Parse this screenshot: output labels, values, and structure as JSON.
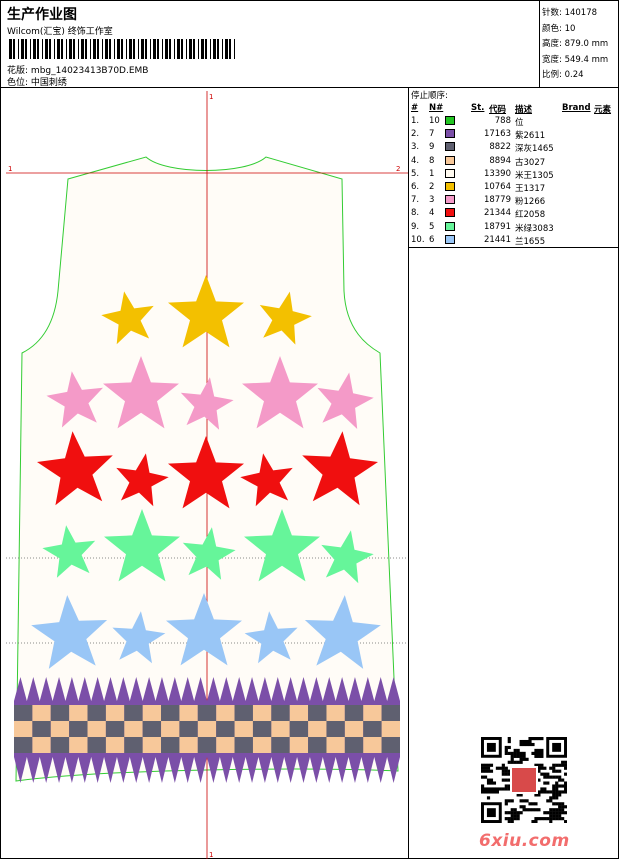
{
  "header": {
    "title": "生产作业图",
    "company": "Wilcom(汇宝) 终饰工作室",
    "design_label": "花版:",
    "design_value": "mbg_14023413B70D.EMB",
    "colorway_label": "色位:",
    "colorway_value": "中国刺绣"
  },
  "specs": [
    {
      "label": "针数:",
      "value": "140178"
    },
    {
      "label": "颜色:",
      "value": "10"
    },
    {
      "label": "高度:",
      "value": "879.0 mm"
    },
    {
      "label": "宽度:",
      "value": "549.4 mm"
    },
    {
      "label": "比例:",
      "value": "0.24"
    }
  ],
  "stop_sequence": {
    "title": "停止顺序:",
    "columns": [
      "#",
      "N#",
      "St.",
      "代码",
      "描述",
      "Brand",
      "元素"
    ],
    "rows": [
      {
        "seq": "1.",
        "needle": "10",
        "color": "#22c522",
        "stitches": "788",
        "desc": "位"
      },
      {
        "seq": "2.",
        "needle": "7",
        "color": "#7b4fa8",
        "stitches": "17163",
        "desc": "紫2611"
      },
      {
        "seq": "3.",
        "needle": "9",
        "color": "#5f6070",
        "stitches": "8822",
        "desc": "深灰1465"
      },
      {
        "seq": "4.",
        "needle": "8",
        "color": "#f7c89a",
        "stitches": "8894",
        "desc": "古3027"
      },
      {
        "seq": "5.",
        "needle": "1",
        "color": "#fffaf0",
        "stitches": "13390",
        "desc": "米王1305"
      },
      {
        "seq": "6.",
        "needle": "2",
        "color": "#f3c000",
        "stitches": "10764",
        "desc": "王1317"
      },
      {
        "seq": "7.",
        "needle": "3",
        "color": "#f49ac8",
        "stitches": "18779",
        "desc": "粉1266"
      },
      {
        "seq": "8.",
        "needle": "4",
        "color": "#f00f0f",
        "stitches": "21344",
        "desc": "红2058"
      },
      {
        "seq": "9.",
        "needle": "5",
        "color": "#66f59a",
        "stitches": "18791",
        "desc": "米绿3083"
      },
      {
        "seq": "10.",
        "needle": "6",
        "color": "#99c6f6",
        "stitches": "21441",
        "desc": "兰1655"
      }
    ]
  },
  "plot": {
    "marker_1": "1",
    "marker_2": "2",
    "marker_top": "1",
    "marker_bottom": "1",
    "outline_color": "#33cc33",
    "axis_color": "#cc0000"
  },
  "watermark": "6xiu.com"
}
